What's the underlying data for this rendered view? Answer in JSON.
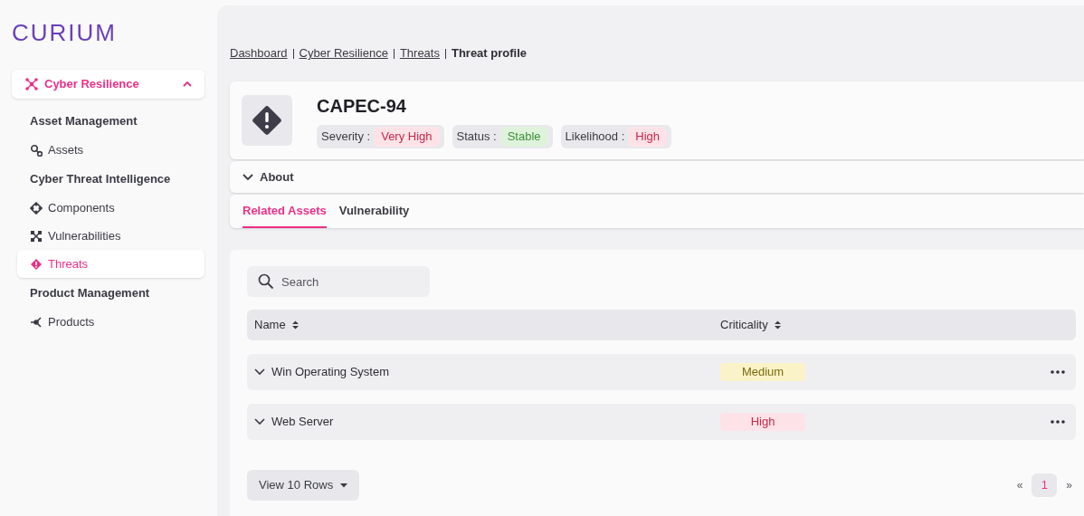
{
  "logo": {
    "text": "CURIUM"
  },
  "sidebar": {
    "group": {
      "label": "Cyber Resilience",
      "expanded": true
    },
    "items": [
      {
        "kind": "heading",
        "label": "Asset Management"
      },
      {
        "kind": "link",
        "label": "Assets",
        "selected": false
      },
      {
        "kind": "heading",
        "label": "Cyber Threat Intelligence"
      },
      {
        "kind": "link",
        "label": "Components",
        "selected": false
      },
      {
        "kind": "link",
        "label": "Vulnerabilities",
        "selected": false
      },
      {
        "kind": "link",
        "label": "Threats",
        "selected": true
      },
      {
        "kind": "heading",
        "label": "Product Management"
      },
      {
        "kind": "link",
        "label": "Products",
        "selected": false
      }
    ]
  },
  "breadcrumbs": [
    {
      "label": "Dashboard",
      "current": false
    },
    {
      "label": "Cyber Resilience",
      "current": false
    },
    {
      "label": "Threats",
      "current": false
    },
    {
      "label": "Threat profile",
      "current": true
    }
  ],
  "threat": {
    "title": "CAPEC-94",
    "tags": [
      {
        "label": "Severity :",
        "value": "Very High",
        "color": "#c8284a"
      },
      {
        "label": "Status :",
        "value": "Stable",
        "color": "#3f8f3a"
      },
      {
        "label": "Likelihood :",
        "value": "High",
        "color": "#c8284a"
      }
    ]
  },
  "about": {
    "label": "About",
    "expanded": false
  },
  "tabs": [
    {
      "label": "Related Assets",
      "selected": true
    },
    {
      "label": "Vulnerability",
      "selected": false
    }
  ],
  "search": {
    "placeholder": "Search"
  },
  "table": {
    "columns": [
      "Name",
      "Criticality"
    ],
    "rows": [
      {
        "name": "Win Operating System",
        "criticality": "Medium",
        "color": "#7a6a10",
        "expanded": false
      },
      {
        "name": "Web Server",
        "criticality": "High",
        "color": "#c8284a",
        "expanded": false
      }
    ]
  },
  "footer": {
    "rows_button": "View 10 Rows",
    "prev": "«",
    "pages": [
      {
        "label": "1",
        "selected": true
      }
    ],
    "next": "»"
  }
}
